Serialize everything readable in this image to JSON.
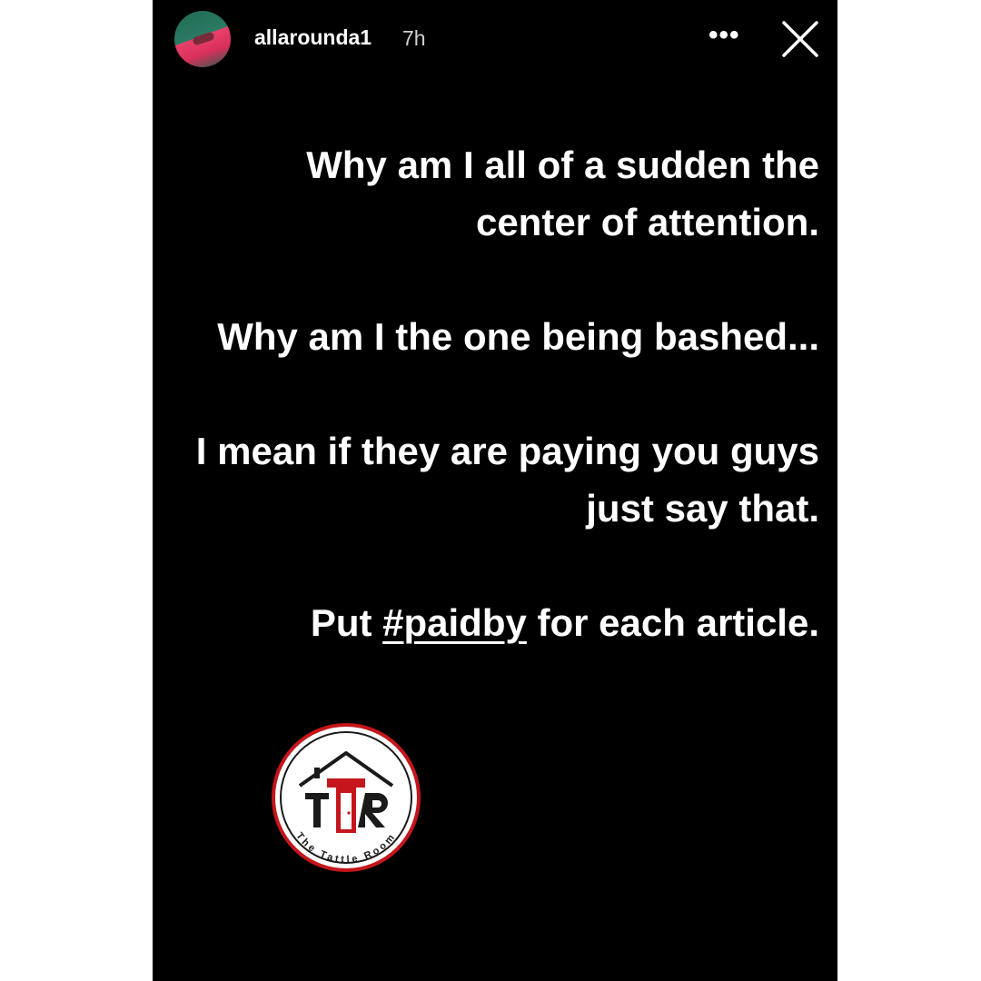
{
  "header": {
    "username": "allarounda1",
    "time_ago": "7h",
    "more_label": "•••",
    "icons": {
      "avatar": "profile-avatar",
      "more": "more-options-icon",
      "close": "close-icon"
    }
  },
  "story": {
    "p1": "Why am I all of a sudden the center of attention.",
    "p2": "Why am I the one being bashed...",
    "p3": "I mean if they are paying you guys just say that.",
    "p4_before": "Put ",
    "p4_hashtag": "#paidby",
    "p4_after": " for each article."
  },
  "watermark": {
    "initials": "TTR",
    "name": "The Tattle Room",
    "colors": {
      "ring": "#c4161c",
      "dark": "#1a1a1a"
    }
  },
  "colors": {
    "background": "#000000",
    "text": "#ffffff",
    "frame": "#ffffff"
  }
}
